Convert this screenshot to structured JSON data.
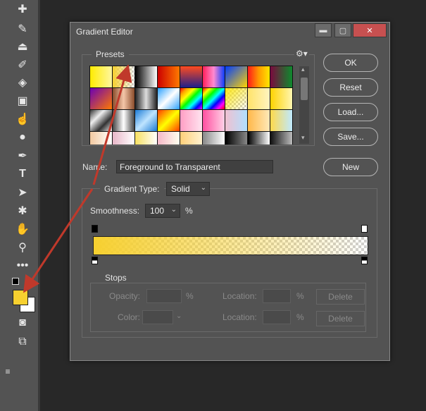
{
  "dialog": {
    "title": "Gradient Editor",
    "presets_label": "Presets",
    "name_label": "Name:",
    "name_value": "Foreground to Transparent",
    "gradient_type_label": "Gradient Type:",
    "gradient_type_value": "Solid",
    "smoothness_label": "Smoothness:",
    "smoothness_value": "100",
    "smoothness_unit": "%",
    "stops_label": "Stops",
    "opacity_label": "Opacity:",
    "opacity_unit": "%",
    "color_label": "Color:",
    "location_label": "Location:",
    "location_unit": "%",
    "delete_label": "Delete"
  },
  "buttons": {
    "ok": "OK",
    "reset": "Reset",
    "load": "Load...",
    "save": "Save...",
    "new": "New"
  },
  "colors": {
    "foreground": "#f7d02f",
    "background": "#ffffff",
    "annotation_arrow": "#c0392b"
  },
  "toolbar_icons": [
    "healing-brush-icon",
    "brush-icon",
    "clone-stamp-icon",
    "history-brush-icon",
    "eraser-icon",
    "gradient-icon",
    "smudge-icon",
    "dodge-icon",
    "pen-icon",
    "type-icon",
    "path-select-icon",
    "shape-icon",
    "hand-icon",
    "zoom-icon",
    "more-tools-icon"
  ]
}
